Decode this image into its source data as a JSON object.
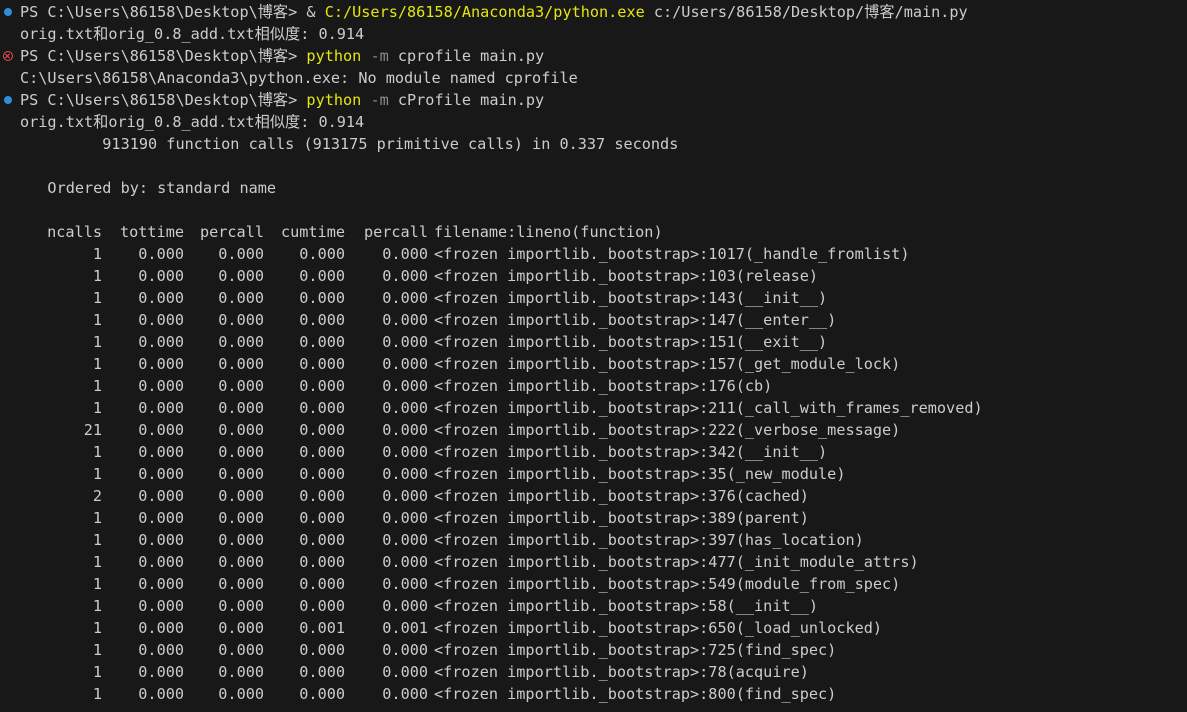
{
  "terminal": {
    "commands": [
      {
        "status": "success",
        "prompt": "PS C:\\Users\\86158\\Desktop\\博客>",
        "parts": [
          {
            "text": " & ",
            "color": "white"
          },
          {
            "text": "C:/Users/86158/Anaconda3/python.exe",
            "color": "yellow"
          },
          {
            "text": " c:/Users/86158/Desktop/博客/main.py",
            "color": "white"
          }
        ],
        "output": [
          "orig.txt和orig_0.8_add.txt相似度: 0.914"
        ]
      },
      {
        "status": "error",
        "prompt": "PS C:\\Users\\86158\\Desktop\\博客>",
        "parts": [
          {
            "text": " ",
            "color": "white"
          },
          {
            "text": "python",
            "color": "yellow"
          },
          {
            "text": " -m",
            "color": "dim"
          },
          {
            "text": " cprofile main.py",
            "color": "white"
          }
        ],
        "output": [
          "C:\\Users\\86158\\Anaconda3\\python.exe: No module named cprofile"
        ]
      },
      {
        "status": "success",
        "prompt": "PS C:\\Users\\86158\\Desktop\\博客>",
        "parts": [
          {
            "text": " ",
            "color": "white"
          },
          {
            "text": "python",
            "color": "yellow"
          },
          {
            "text": " -m",
            "color": "dim"
          },
          {
            "text": " cProfile main.py",
            "color": "white"
          }
        ],
        "output": [
          "orig.txt和orig_0.8_add.txt相似度: 0.914",
          "         913190 function calls (913175 primitive calls) in 0.337 seconds",
          "",
          "   Ordered by: standard name",
          ""
        ]
      }
    ],
    "profile": {
      "headers": [
        "ncalls",
        "tottime",
        "percall",
        "cumtime",
        "percall",
        "filename:lineno(function)"
      ],
      "rows": [
        [
          "1",
          "0.000",
          "0.000",
          "0.000",
          "0.000",
          "<frozen importlib._bootstrap>:1017(_handle_fromlist)"
        ],
        [
          "1",
          "0.000",
          "0.000",
          "0.000",
          "0.000",
          "<frozen importlib._bootstrap>:103(release)"
        ],
        [
          "1",
          "0.000",
          "0.000",
          "0.000",
          "0.000",
          "<frozen importlib._bootstrap>:143(__init__)"
        ],
        [
          "1",
          "0.000",
          "0.000",
          "0.000",
          "0.000",
          "<frozen importlib._bootstrap>:147(__enter__)"
        ],
        [
          "1",
          "0.000",
          "0.000",
          "0.000",
          "0.000",
          "<frozen importlib._bootstrap>:151(__exit__)"
        ],
        [
          "1",
          "0.000",
          "0.000",
          "0.000",
          "0.000",
          "<frozen importlib._bootstrap>:157(_get_module_lock)"
        ],
        [
          "1",
          "0.000",
          "0.000",
          "0.000",
          "0.000",
          "<frozen importlib._bootstrap>:176(cb)"
        ],
        [
          "1",
          "0.000",
          "0.000",
          "0.000",
          "0.000",
          "<frozen importlib._bootstrap>:211(_call_with_frames_removed)"
        ],
        [
          "21",
          "0.000",
          "0.000",
          "0.000",
          "0.000",
          "<frozen importlib._bootstrap>:222(_verbose_message)"
        ],
        [
          "1",
          "0.000",
          "0.000",
          "0.000",
          "0.000",
          "<frozen importlib._bootstrap>:342(__init__)"
        ],
        [
          "1",
          "0.000",
          "0.000",
          "0.000",
          "0.000",
          "<frozen importlib._bootstrap>:35(_new_module)"
        ],
        [
          "2",
          "0.000",
          "0.000",
          "0.000",
          "0.000",
          "<frozen importlib._bootstrap>:376(cached)"
        ],
        [
          "1",
          "0.000",
          "0.000",
          "0.000",
          "0.000",
          "<frozen importlib._bootstrap>:389(parent)"
        ],
        [
          "1",
          "0.000",
          "0.000",
          "0.000",
          "0.000",
          "<frozen importlib._bootstrap>:397(has_location)"
        ],
        [
          "1",
          "0.000",
          "0.000",
          "0.000",
          "0.000",
          "<frozen importlib._bootstrap>:477(_init_module_attrs)"
        ],
        [
          "1",
          "0.000",
          "0.000",
          "0.000",
          "0.000",
          "<frozen importlib._bootstrap>:549(module_from_spec)"
        ],
        [
          "1",
          "0.000",
          "0.000",
          "0.000",
          "0.000",
          "<frozen importlib._bootstrap>:58(__init__)"
        ],
        [
          "1",
          "0.000",
          "0.000",
          "0.001",
          "0.001",
          "<frozen importlib._bootstrap>:650(_load_unlocked)"
        ],
        [
          "1",
          "0.000",
          "0.000",
          "0.000",
          "0.000",
          "<frozen importlib._bootstrap>:725(find_spec)"
        ],
        [
          "1",
          "0.000",
          "0.000",
          "0.000",
          "0.000",
          "<frozen importlib._bootstrap>:78(acquire)"
        ],
        [
          "1",
          "0.000",
          "0.000",
          "0.000",
          "0.000",
          "<frozen importlib._bootstrap>:800(find_spec)"
        ]
      ]
    },
    "colors": {
      "background": "#181818",
      "text": "#cccccc",
      "command": "#e5e510",
      "flag": "#8b8b8b",
      "success_dot": "#2e8fd6",
      "error_dot": "#f14c4c"
    }
  }
}
